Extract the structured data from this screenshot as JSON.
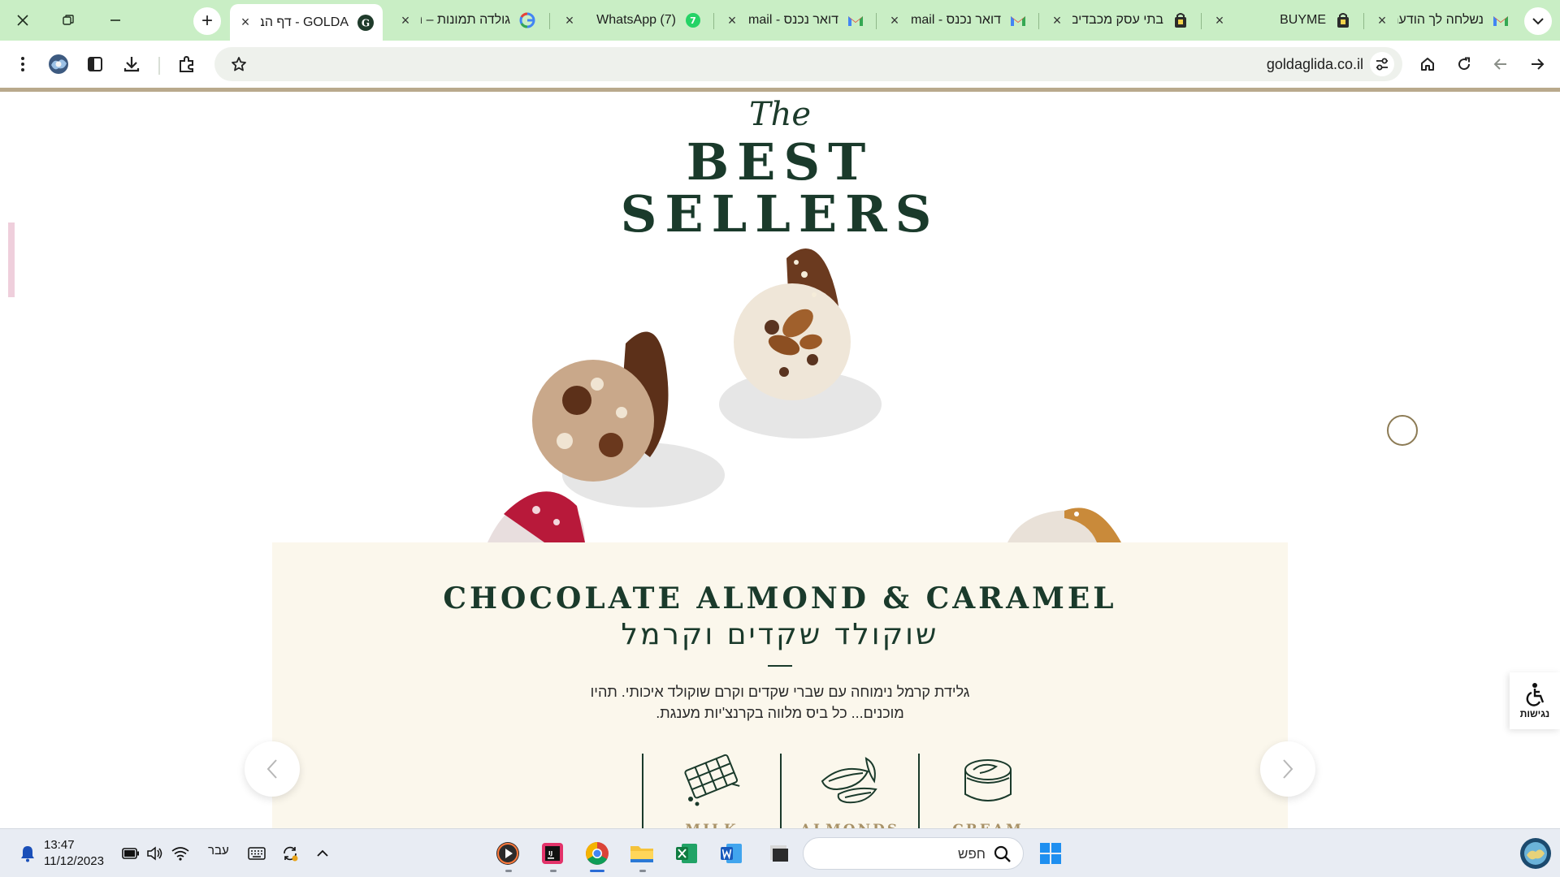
{
  "browser": {
    "tabs": [
      {
        "title": "נשלחה לך הודעה",
        "favicon": "gmail-icon"
      },
      {
        "title": "BUYME",
        "favicon": "buyme-icon"
      },
      {
        "title": "בתי עסק מכבדים",
        "favicon": "buyme-icon"
      },
      {
        "title": "דואר נכנס - mail",
        "favicon": "gmail-icon"
      },
      {
        "title": "דואר נכנס - mail",
        "favicon": "gmail-icon"
      },
      {
        "title": "(7) WhatsApp",
        "favicon": "whatsapp-icon"
      },
      {
        "title": "גולדה תמונות – ח",
        "favicon": "google-icon"
      },
      {
        "title": "GOLDA - דף הבית",
        "favicon": "golda-icon",
        "active": true
      }
    ],
    "url": "goldaglida.co.il"
  },
  "hero": {
    "kicker": "The",
    "title_line1": "BEST",
    "title_line2": "SELLERS"
  },
  "product": {
    "name_en": "CHOCOLATE ALMOND & CARAMEL",
    "name_he": "שוקולד שקדים וקרמל",
    "description_line1": "גלידת קרמל נימוחה עם שברי שקדים וקרם שוקולד איכותי. תהיו",
    "description_line2": "מוכנים... כל ביס מלווה בקרנצ'יות מענגת.",
    "ingredients": [
      {
        "label": "MILK",
        "icon": "chocolate-bar-icon"
      },
      {
        "label": "ALMONDS",
        "icon": "almond-icon"
      },
      {
        "label": "CREAM",
        "icon": "cream-jar-icon"
      }
    ]
  },
  "accessibility": {
    "label": "נגישות"
  },
  "taskbar": {
    "time": "13:47",
    "date": "11/12/2023",
    "language": "עבר",
    "search_placeholder": "חפש"
  },
  "colors": {
    "tabstrip": "#c9eec5",
    "brand_green": "#1a3a2b",
    "card_bg": "#fbf7ec",
    "gold": "#a89268"
  }
}
